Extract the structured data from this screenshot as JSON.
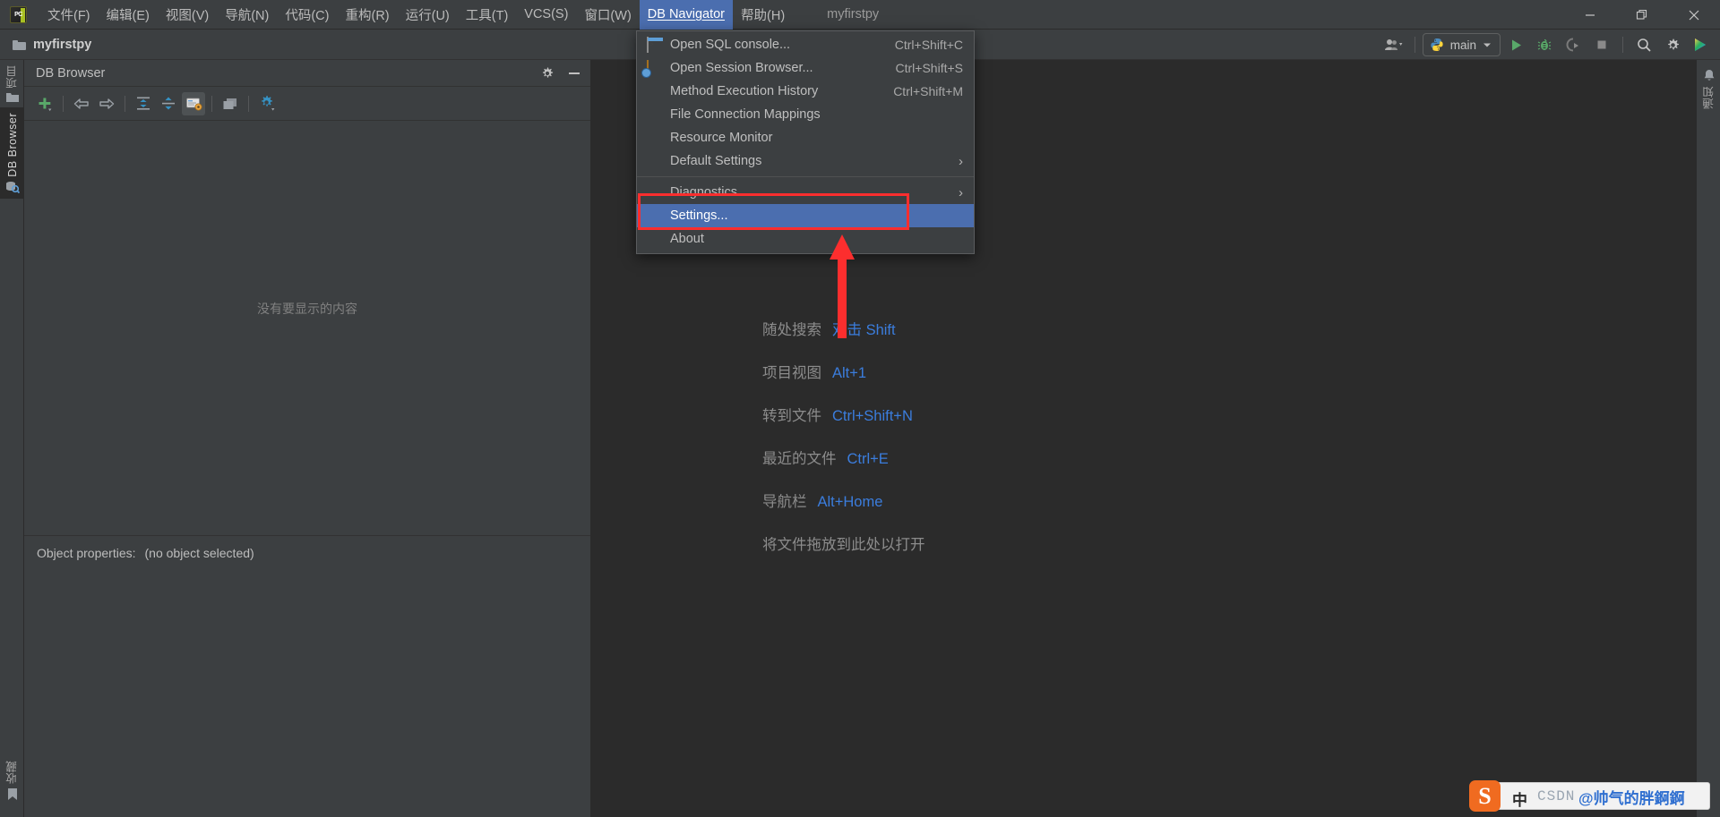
{
  "window": {
    "title": "myfirstpy",
    "controls": {
      "minimize": "minimize-icon",
      "maximize": "maximize-icon",
      "close": "close-icon"
    }
  },
  "menubar": {
    "items": [
      {
        "label": "文件(F)",
        "active": false
      },
      {
        "label": "编辑(E)",
        "active": false
      },
      {
        "label": "视图(V)",
        "active": false
      },
      {
        "label": "导航(N)",
        "active": false
      },
      {
        "label": "代码(C)",
        "active": false
      },
      {
        "label": "重构(R)",
        "active": false
      },
      {
        "label": "运行(U)",
        "active": false
      },
      {
        "label": "工具(T)",
        "active": false
      },
      {
        "label": "VCS(S)",
        "active": false
      },
      {
        "label": "窗口(W)",
        "active": false
      },
      {
        "label": "DB Navigator",
        "active": true
      },
      {
        "label": "帮助(H)",
        "active": false
      }
    ]
  },
  "breadcrumb": {
    "project": "myfirstpy",
    "icon": "folder-icon"
  },
  "toolbar_right": {
    "profile_icon": "user-group-icon",
    "run_config": {
      "label": "main",
      "icon": "python-icon",
      "chevron": "chevron-down-icon"
    },
    "run_icon": "run-icon",
    "debug_icon": "debug-icon",
    "coverage_icon": "run-with-coverage-icon",
    "stop_icon": "stop-icon",
    "search_icon": "search-everywhere-icon",
    "settings_icon": "gear-icon",
    "updates_icon": "datalore-icon"
  },
  "left_strip": {
    "tabs": [
      {
        "label": "项目",
        "icon": "project-folder-icon",
        "selected": false
      },
      {
        "label": "DB Browser",
        "icon": "db-browser-icon",
        "selected": true
      }
    ],
    "bottom_tabs": [
      {
        "label": "收藏",
        "icon": "bookmark-icon",
        "selected": false
      }
    ]
  },
  "right_strip": {
    "tabs": [
      {
        "label": "通知",
        "icon": "bell-icon",
        "selected": false
      }
    ]
  },
  "db_browser": {
    "title": "DB Browser",
    "header_buttons": [
      {
        "name": "settings",
        "icon": "gear-icon"
      },
      {
        "name": "hide",
        "icon": "minimize-icon"
      }
    ],
    "toolbar": [
      {
        "name": "new-connection",
        "icon": "plus-icon"
      },
      {
        "name": "navigate-back",
        "icon": "arrow-left-icon"
      },
      {
        "name": "navigate-forward",
        "icon": "arrow-right-icon"
      },
      {
        "name": "expand-all",
        "icon": "expand-all-icon"
      },
      {
        "name": "collapse-all",
        "icon": "collapse-all-icon"
      },
      {
        "name": "show-object-properties",
        "icon": "object-properties-icon",
        "pressed": true
      },
      {
        "name": "duplicate",
        "icon": "copy-icon"
      },
      {
        "name": "settings",
        "icon": "gear-icon"
      }
    ],
    "empty_message": "没有要显示的内容",
    "object_properties_label": "Object properties:",
    "object_properties_value": "(no object selected)"
  },
  "dropdown": {
    "owner": "DB Navigator",
    "items": [
      {
        "label": "Open SQL console...",
        "shortcut": "Ctrl+Shift+C",
        "icon": "sql-console-icon",
        "submenu": false,
        "highlighted": false
      },
      {
        "label": "Open Session Browser...",
        "shortcut": "Ctrl+Shift+S",
        "icon": "session-browser-icon",
        "submenu": false,
        "highlighted": false
      },
      {
        "label": "Method Execution History",
        "shortcut": "Ctrl+Shift+M",
        "icon": null,
        "submenu": false,
        "highlighted": false
      },
      {
        "label": "File Connection Mappings",
        "shortcut": "",
        "icon": null,
        "submenu": false,
        "highlighted": false
      },
      {
        "label": "Resource Monitor",
        "shortcut": "",
        "icon": null,
        "submenu": false,
        "highlighted": false
      },
      {
        "label": "Default Settings",
        "shortcut": "",
        "icon": null,
        "submenu": true,
        "highlighted": false
      },
      {
        "separator": true
      },
      {
        "label": "Diagnostics",
        "shortcut": "",
        "icon": null,
        "submenu": true,
        "highlighted": false
      },
      {
        "label": "Settings...",
        "shortcut": "",
        "icon": null,
        "submenu": false,
        "highlighted": true
      },
      {
        "label": "About",
        "shortcut": "",
        "icon": null,
        "submenu": false,
        "highlighted": false
      }
    ]
  },
  "editor_hints": {
    "rows": [
      {
        "label": "随处搜索",
        "key": "双击 Shift"
      },
      {
        "label": "项目视图",
        "key": "Alt+1"
      },
      {
        "label": "转到文件",
        "key": "Ctrl+Shift+N"
      },
      {
        "label": "最近的文件",
        "key": "Ctrl+E"
      },
      {
        "label": "导航栏",
        "key": "Alt+Home"
      },
      {
        "label": "将文件拖放到此处以打开",
        "key": ""
      }
    ]
  },
  "annotation": {
    "highlight_target": "Settings...",
    "box_color": "#fc2e2e",
    "arrow_color": "#fc2e2e"
  },
  "watermark": {
    "ime_logo": "S",
    "ime_mode": "中",
    "site": "CSDN",
    "handle": "@帅气的胖錒錒"
  },
  "colors": {
    "window_bg": "#3c3f41",
    "editor_bg": "#2b2b2b",
    "menu_highlight": "#4b6eaf",
    "hint_key": "#3b7ddd",
    "text": "#bfbfbf",
    "annotation": "#fc2e2e"
  }
}
